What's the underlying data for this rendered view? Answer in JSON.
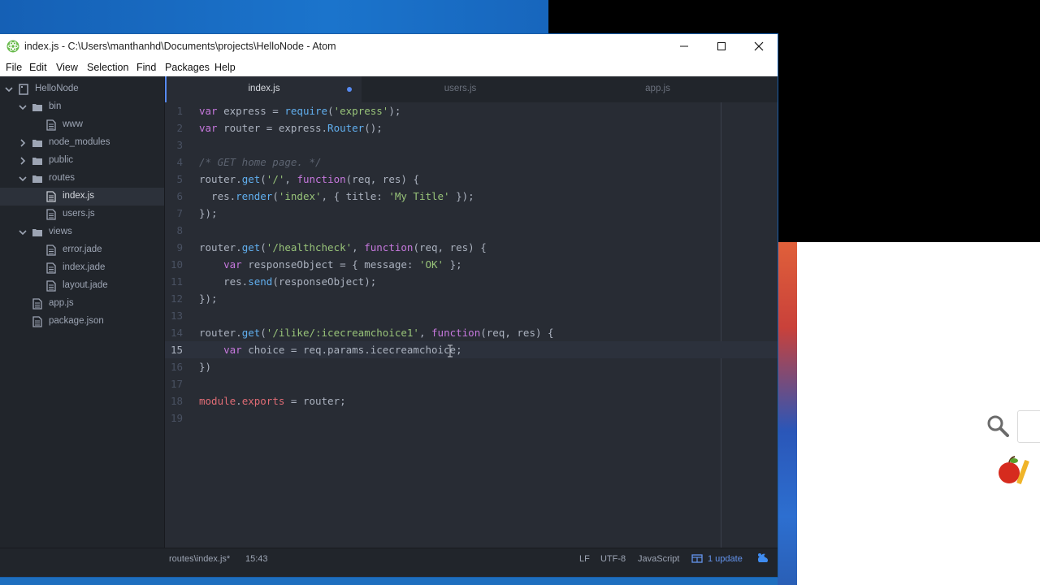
{
  "window": {
    "title": "index.js - C:\\Users\\manthanhd\\Documents\\projects\\HelloNode - Atom"
  },
  "menu": [
    "File",
    "Edit",
    "View",
    "Selection",
    "Find",
    "Packages",
    "Help"
  ],
  "tree": {
    "root": "HelloNode",
    "items": [
      {
        "label": "HelloNode",
        "kind": "folder",
        "expanded": true
      },
      {
        "label": "bin",
        "kind": "folder",
        "expanded": true
      },
      {
        "label": "www",
        "kind": "file"
      },
      {
        "label": "node_modules",
        "kind": "folder",
        "expanded": false
      },
      {
        "label": "public",
        "kind": "folder",
        "expanded": false
      },
      {
        "label": "routes",
        "kind": "folder",
        "expanded": true
      },
      {
        "label": "index.js",
        "kind": "file",
        "selected": true
      },
      {
        "label": "users.js",
        "kind": "file"
      },
      {
        "label": "views",
        "kind": "folder",
        "expanded": true
      },
      {
        "label": "error.jade",
        "kind": "file"
      },
      {
        "label": "index.jade",
        "kind": "file"
      },
      {
        "label": "layout.jade",
        "kind": "file"
      },
      {
        "label": "app.js",
        "kind": "file"
      },
      {
        "label": "package.json",
        "kind": "file"
      }
    ]
  },
  "tabs": [
    {
      "label": "index.js",
      "active": true,
      "modified": true
    },
    {
      "label": "users.js",
      "active": false,
      "modified": false
    },
    {
      "label": "app.js",
      "active": false,
      "modified": false
    }
  ],
  "editor": {
    "cursor_line": 15,
    "lines": [
      "1",
      "2",
      "3",
      "4",
      "5",
      "6",
      "7",
      "8",
      "9",
      "10",
      "11",
      "12",
      "13",
      "14",
      "15",
      "16",
      "17",
      "18",
      "19"
    ]
  },
  "status": {
    "path": "routes\\index.js*",
    "position": "15:43",
    "line_ending": "LF",
    "encoding": "UTF-8",
    "grammar": "JavaScript",
    "updates": "1 update"
  },
  "colors": {
    "accent": "#568af2",
    "editor_bg": "#282c34",
    "tree_bg": "#21252b"
  }
}
